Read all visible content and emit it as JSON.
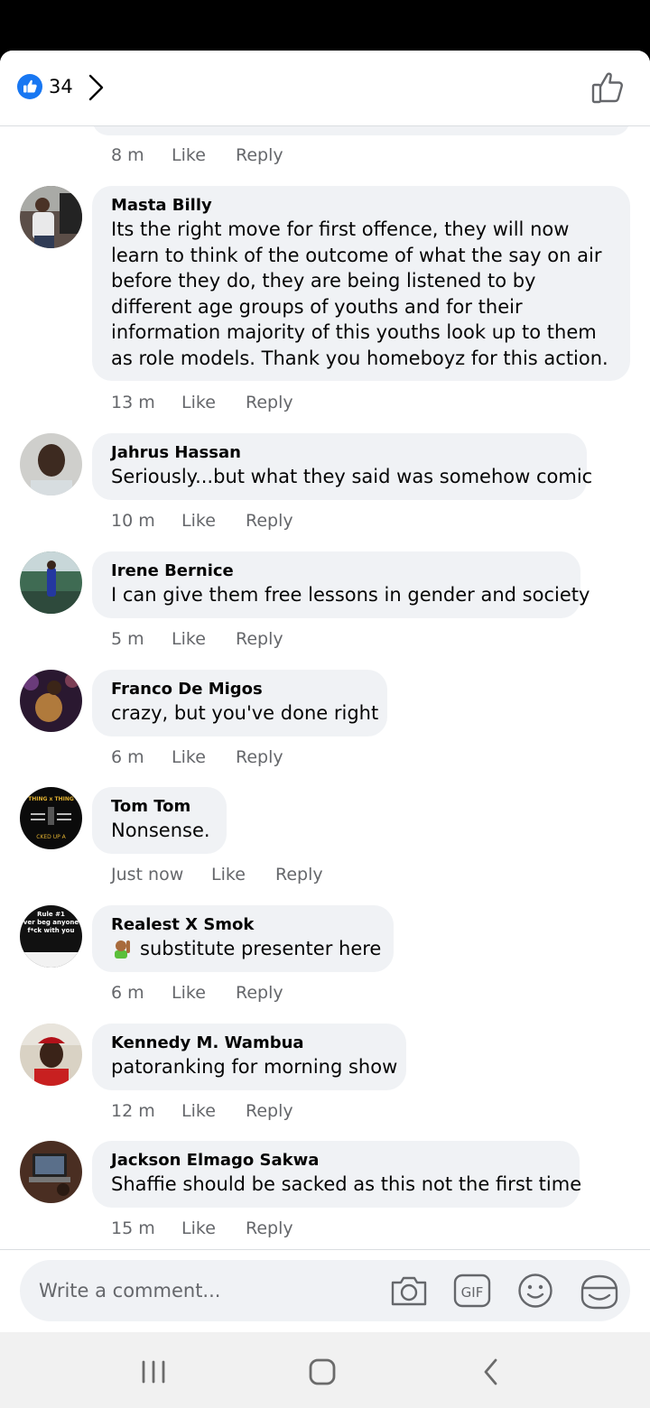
{
  "reactions": {
    "count": "34"
  },
  "previous_comment": {
    "time": "8 m",
    "like": "Like",
    "reply": "Reply"
  },
  "comments": [
    {
      "name": "Masta Billy",
      "text": "Its the right move for first offence, they will now learn to think of the outcome of what the say on air before they do, they are being listened to by different age groups of youths and for their information majority of this youths look up to them as role models. Thank you homeboyz for this action.",
      "time": "13 m",
      "like": "Like",
      "reply": "Reply"
    },
    {
      "name": "Jahrus Hassan",
      "text": "Seriously...but what they said was somehow comic",
      "time": "10 m",
      "like": "Like",
      "reply": "Reply"
    },
    {
      "name": "Irene Bernice",
      "text": "I can give them free lessons in gender and society",
      "time": "5 m",
      "like": "Like",
      "reply": "Reply"
    },
    {
      "name": "Franco De Migos",
      "text": "crazy, but you've done right",
      "time": "6 m",
      "like": "Like",
      "reply": "Reply"
    },
    {
      "name": "Tom Tom",
      "text": "Nonsense.",
      "time": "Just now",
      "like": "Like",
      "reply": "Reply"
    },
    {
      "name": "Realest X Smok",
      "text": "substitute presenter here",
      "time": "6 m",
      "like": "Like",
      "reply": "Reply"
    },
    {
      "name": "Kennedy M. Wambua",
      "text": "patoranking for morning show",
      "time": "12 m",
      "like": "Like",
      "reply": "Reply"
    },
    {
      "name": "Jackson Elmago Sakwa",
      "text": "Shaffie should be sacked as this not the first time",
      "time": "15 m",
      "like": "Like",
      "reply": "Reply"
    }
  ],
  "avatar_texts": {
    "tomtom_top": "THING x THING",
    "tomtom_bottom": "CKED UP A",
    "realest_lines": [
      "Rule #1",
      "ver beg anyone",
      "f*ck with you"
    ]
  },
  "composer": {
    "placeholder": "Write a comment..."
  },
  "icons": [
    "like-reaction-icon",
    "chevron-right-icon",
    "thumbs-up-icon",
    "camera-icon",
    "gif-icon",
    "emoji-icon",
    "sticker-icon",
    "recents-nav-icon",
    "home-nav-icon",
    "back-nav-icon"
  ],
  "colors": {
    "accent": "#1877f2",
    "bubble": "#f0f2f5",
    "meta": "#65676b",
    "text": "#050505"
  }
}
